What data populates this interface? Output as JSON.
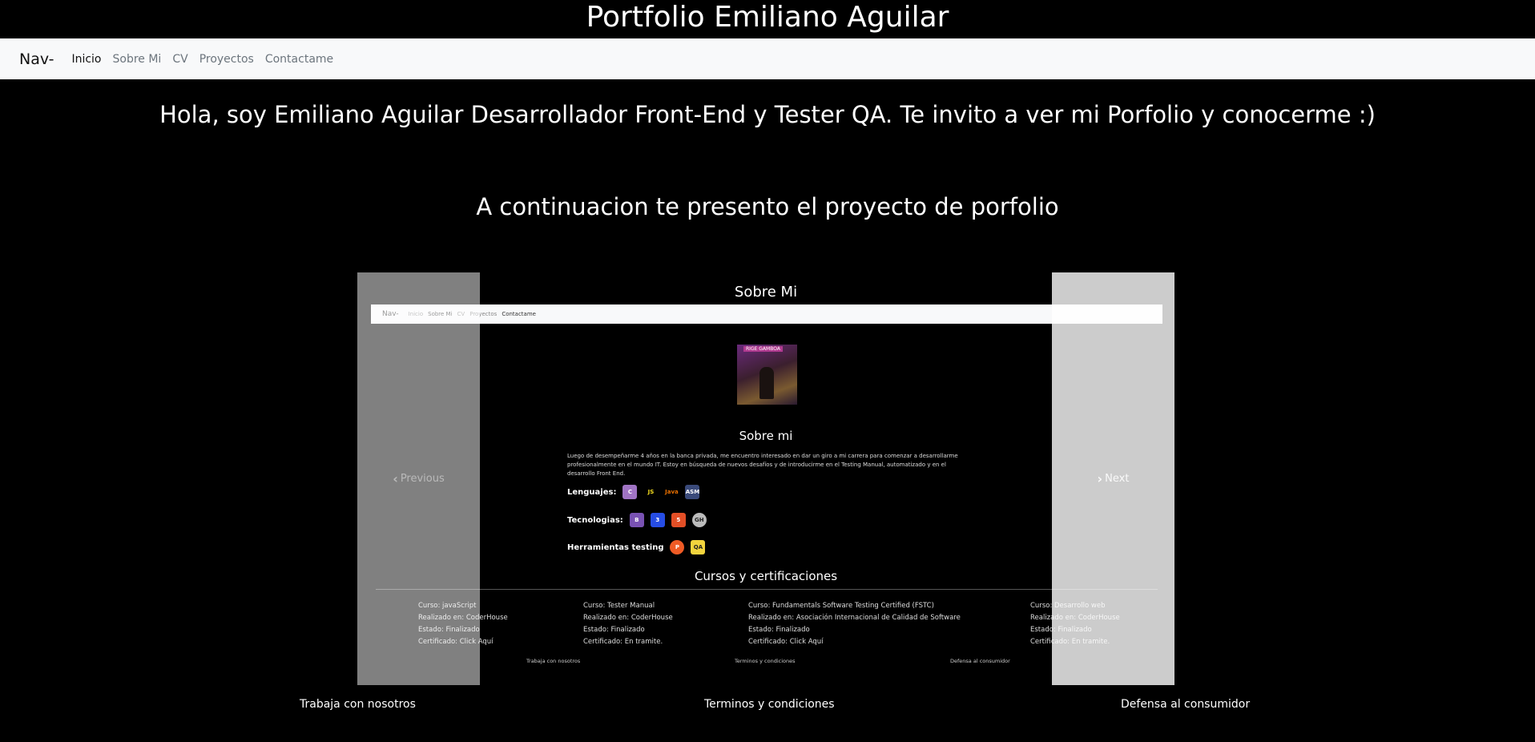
{
  "header": {
    "title": "Portfolio Emiliano Aguilar"
  },
  "navbar": {
    "brand": "Nav-",
    "links": [
      "Inicio",
      "Sobre Mi",
      "CV",
      "Proyectos",
      "Contactame"
    ]
  },
  "main": {
    "intro": "Hola, soy Emiliano Aguilar Desarrollador Front-End y Tester QA. Te invito a ver mi Porfolio y conocerme :)",
    "subtitle": "A continuacion te presento el proyecto de porfolio"
  },
  "carousel": {
    "prev_label": "Previous",
    "next_label": "Next",
    "slide": {
      "title": "Sobre Mi",
      "nav": {
        "brand": "Nav-",
        "links": [
          "Inicio",
          "Sobre Mi",
          "CV",
          "Proyectos",
          "Contactame"
        ]
      },
      "photo_label": "RIGE GAMBOA",
      "section_title": "Sobre mi",
      "description": "Luego de desempeñarme 4 años en la banca privada, me encuentro interesado en dar un giro a mi carrera para comenzar a desarrollarme profesionalmente en el mundo IT. Estoy en búsqueda de nuevos desafíos y de introducirme en el Testing Manual, automatizado y en el desarrollo Front End.",
      "lenguajes_label": "Lenguajes:",
      "lenguajes_icons": [
        "C",
        "JS",
        "Java",
        "ASM"
      ],
      "tecnologias_label": "Tecnologias:",
      "tecnologias_icons": [
        "B",
        "3",
        "5",
        "GH"
      ],
      "herramientas_label": "Herramientas testing",
      "herramientas_icons": [
        "P",
        "QA"
      ],
      "cursos_title": "Cursos y certificaciones",
      "courses": [
        {
          "curso": "Curso: javaScript",
          "lugar": "Realizado en: CoderHouse",
          "estado": "Estado: Finalizado",
          "cert": "Certificado: Click Aquí"
        },
        {
          "curso": "Curso: Tester Manual",
          "lugar": "Realizado en: CoderHouse",
          "estado": "Estado: Finalizado",
          "cert": "Certificado: En tramite."
        },
        {
          "curso": "Curso: Fundamentals Software Testing Certified (FSTC)",
          "lugar": "Realizado en: Asociación Internacional de Calidad de Software",
          "estado": "Estado: Finalizado",
          "cert": "Certificado: Click Aquí"
        },
        {
          "curso": "Curso: Desarrollo web",
          "lugar": "Realizado en: CoderHouse",
          "estado": "Estado: Finalizado",
          "cert": "Certificado: En tramite."
        }
      ],
      "footer": [
        "Trabaja con nosotros",
        "Terminos y condiciones",
        "Defensa al consumidor"
      ]
    }
  },
  "footer": {
    "links": [
      "Trabaja con nosotros",
      "Terminos y condiciones",
      "Defensa al consumidor"
    ]
  },
  "colors": {
    "background": "#000000",
    "navbar_bg": "#f8f9fa",
    "nav_link": "#6c757d"
  }
}
